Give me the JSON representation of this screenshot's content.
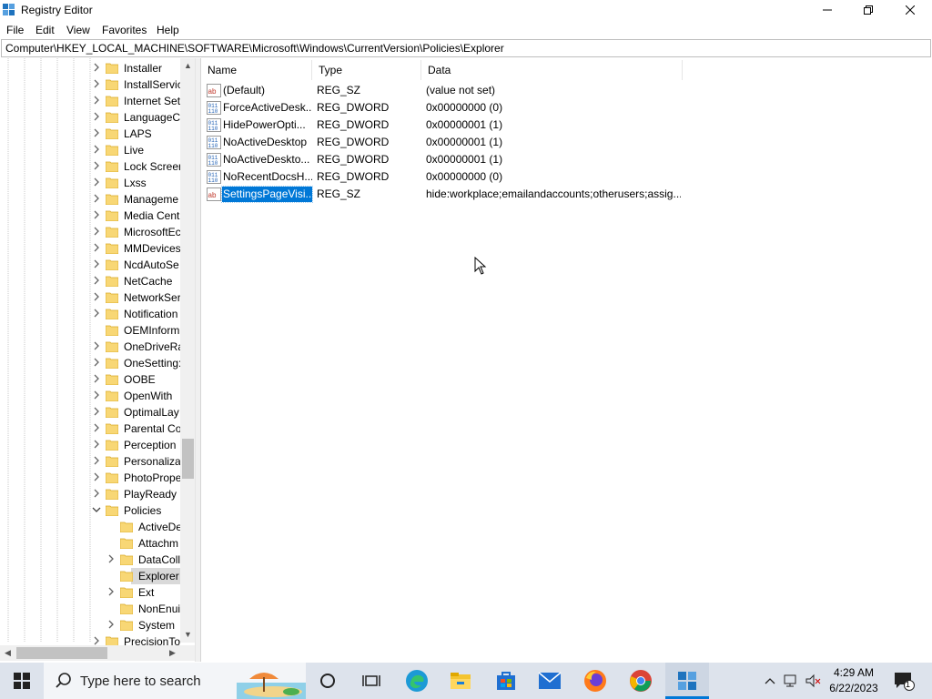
{
  "window": {
    "title": "Registry Editor"
  },
  "menu": [
    "File",
    "Edit",
    "View",
    "Favorites",
    "Help"
  ],
  "address": "Computer\\HKEY_LOCAL_MACHINE\\SOFTWARE\\Microsoft\\Windows\\CurrentVersion\\Policies\\Explorer",
  "tree": {
    "items": [
      {
        "label": "Installer",
        "level": 1,
        "expander": "collapsed"
      },
      {
        "label": "InstallServic",
        "level": 1,
        "expander": "collapsed"
      },
      {
        "label": "Internet Set",
        "level": 1,
        "expander": "collapsed"
      },
      {
        "label": "LanguageC",
        "level": 1,
        "expander": "collapsed"
      },
      {
        "label": "LAPS",
        "level": 1,
        "expander": "collapsed"
      },
      {
        "label": "Live",
        "level": 1,
        "expander": "collapsed"
      },
      {
        "label": "Lock Screer",
        "level": 1,
        "expander": "collapsed"
      },
      {
        "label": "Lxss",
        "level": 1,
        "expander": "collapsed"
      },
      {
        "label": "Manageme",
        "level": 1,
        "expander": "collapsed"
      },
      {
        "label": "Media Cent",
        "level": 1,
        "expander": "collapsed"
      },
      {
        "label": "MicrosoftEc",
        "level": 1,
        "expander": "collapsed"
      },
      {
        "label": "MMDevices",
        "level": 1,
        "expander": "collapsed"
      },
      {
        "label": "NcdAutoSe",
        "level": 1,
        "expander": "collapsed"
      },
      {
        "label": "NetCache",
        "level": 1,
        "expander": "collapsed"
      },
      {
        "label": "NetworkSer",
        "level": 1,
        "expander": "collapsed"
      },
      {
        "label": "Notification",
        "level": 1,
        "expander": "collapsed"
      },
      {
        "label": "OEMInform",
        "level": 1,
        "expander": "none"
      },
      {
        "label": "OneDriveRa",
        "level": 1,
        "expander": "collapsed"
      },
      {
        "label": "OneSetting:",
        "level": 1,
        "expander": "collapsed"
      },
      {
        "label": "OOBE",
        "level": 1,
        "expander": "collapsed"
      },
      {
        "label": "OpenWith",
        "level": 1,
        "expander": "collapsed"
      },
      {
        "label": "OptimalLay",
        "level": 1,
        "expander": "collapsed"
      },
      {
        "label": "Parental Co",
        "level": 1,
        "expander": "collapsed"
      },
      {
        "label": "Perception",
        "level": 1,
        "expander": "collapsed"
      },
      {
        "label": "Personalizat",
        "level": 1,
        "expander": "collapsed"
      },
      {
        "label": "PhotoPrope",
        "level": 1,
        "expander": "collapsed"
      },
      {
        "label": "PlayReady",
        "level": 1,
        "expander": "collapsed"
      },
      {
        "label": "Policies",
        "level": 1,
        "expander": "expanded"
      },
      {
        "label": "ActiveDe",
        "level": 2,
        "expander": "none"
      },
      {
        "label": "Attachm",
        "level": 2,
        "expander": "none"
      },
      {
        "label": "DataColl",
        "level": 2,
        "expander": "collapsed"
      },
      {
        "label": "Explorer",
        "level": 2,
        "expander": "none",
        "selected": true
      },
      {
        "label": "Ext",
        "level": 2,
        "expander": "collapsed"
      },
      {
        "label": "NonEnui",
        "level": 2,
        "expander": "none"
      },
      {
        "label": "System",
        "level": 2,
        "expander": "collapsed"
      },
      {
        "label": "PrecisionTo",
        "level": 1,
        "expander": "collapsed"
      }
    ]
  },
  "list": {
    "columns": [
      "Name",
      "Type",
      "Data"
    ],
    "rows": [
      {
        "icon": "string-value-icon",
        "name": "(Default)",
        "type": "REG_SZ",
        "data": "(value not set)"
      },
      {
        "icon": "binary-value-icon",
        "name": "ForceActiveDesk...",
        "type": "REG_DWORD",
        "data": "0x00000000 (0)"
      },
      {
        "icon": "binary-value-icon",
        "name": "HidePowerOpti...",
        "type": "REG_DWORD",
        "data": "0x00000001 (1)"
      },
      {
        "icon": "binary-value-icon",
        "name": "NoActiveDesktop",
        "type": "REG_DWORD",
        "data": "0x00000001 (1)"
      },
      {
        "icon": "binary-value-icon",
        "name": "NoActiveDeskto...",
        "type": "REG_DWORD",
        "data": "0x00000001 (1)"
      },
      {
        "icon": "binary-value-icon",
        "name": "NoRecentDocsH...",
        "type": "REG_DWORD",
        "data": "0x00000000 (0)"
      },
      {
        "icon": "string-value-icon",
        "name": "SettingsPageVisi...",
        "type": "REG_SZ",
        "data": "hide:workplace;emailandaccounts;otherusers;assig...",
        "selected": true
      }
    ]
  },
  "taskbar": {
    "search_placeholder": "Type here to search",
    "apps": [
      "cortana-icon",
      "task-view-icon",
      "edge-icon",
      "file-explorer-icon",
      "store-icon",
      "mail-icon",
      "firefox-icon",
      "chrome-icon",
      "regedit-icon"
    ],
    "time": "4:29 AM",
    "date": "6/22/2023",
    "notification_count": "1"
  },
  "colors": {
    "selection": "#0078d7",
    "folder": "#f8d775",
    "taskbar": "#dde3ec"
  }
}
